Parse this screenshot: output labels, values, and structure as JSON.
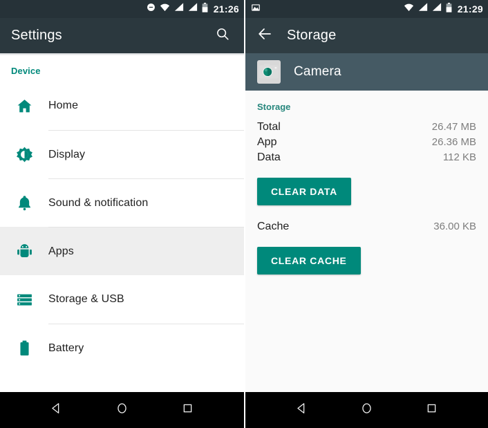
{
  "left": {
    "statusbar": {
      "time": "21:26",
      "icons": [
        "do-not-disturb-icon",
        "wifi-icon",
        "signal-icon",
        "signal-icon",
        "battery-icon"
      ]
    },
    "toolbar": {
      "title": "Settings",
      "search_icon": "search-icon"
    },
    "section_label": "Device",
    "items": [
      {
        "label": "Home",
        "icon": "home-icon",
        "selected": false
      },
      {
        "label": "Display",
        "icon": "brightness-icon",
        "selected": false
      },
      {
        "label": "Sound & notification",
        "icon": "bell-icon",
        "selected": false
      },
      {
        "label": "Apps",
        "icon": "android-robot-icon",
        "selected": true
      },
      {
        "label": "Storage & USB",
        "icon": "storage-list-icon",
        "selected": false
      },
      {
        "label": "Battery",
        "icon": "battery-icon",
        "selected": false
      }
    ]
  },
  "right": {
    "statusbar": {
      "time": "21:29",
      "notification_icon": "screenshot-image-icon",
      "icons": [
        "wifi-icon",
        "signal-icon",
        "signal-icon",
        "battery-icon"
      ]
    },
    "toolbar": {
      "back_icon": "arrow-back-icon",
      "title": "Storage"
    },
    "app": {
      "name": "Camera",
      "icon": "camera-app-icon"
    },
    "storage_section": {
      "title": "Storage",
      "rows": [
        {
          "key": "Total",
          "value": "26.47 MB"
        },
        {
          "key": "App",
          "value": "26.36 MB"
        },
        {
          "key": "Data",
          "value": "112 KB"
        }
      ],
      "clear_data_label": "CLEAR DATA",
      "cache": {
        "key": "Cache",
        "value": "36.00 KB"
      },
      "clear_cache_label": "CLEAR CACHE"
    }
  },
  "navbar": {
    "back": "back-triangle-icon",
    "home": "home-circle-icon",
    "recents": "recents-square-icon"
  },
  "colors": {
    "accent": "#00897b",
    "toolbar": "#2b383e",
    "statusbar": "#263238",
    "app_header": "#455a64",
    "selected_row": "#eeeeee"
  }
}
